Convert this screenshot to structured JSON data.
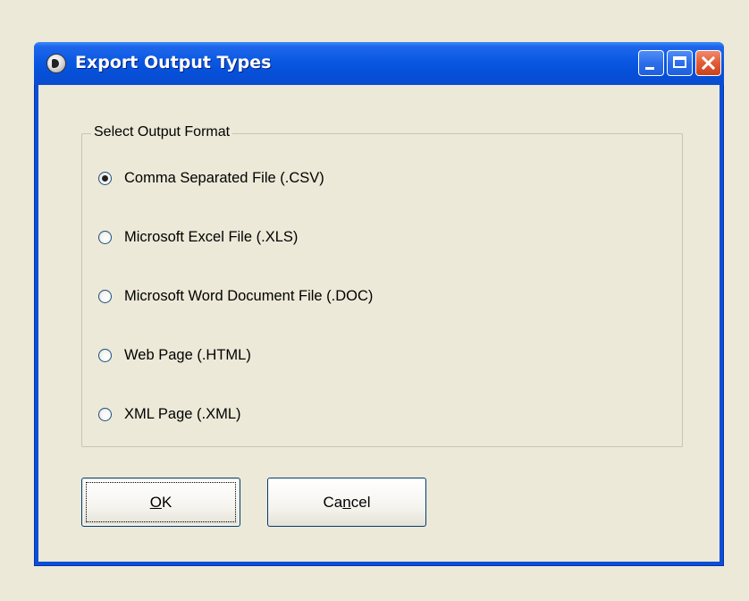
{
  "window": {
    "title": "Export Output Types",
    "icon": "app-globe-icon"
  },
  "titlebar_buttons": {
    "minimize": "minimize-icon",
    "maximize": "maximize-icon",
    "close": "close-icon"
  },
  "group": {
    "label": "Select Output Format",
    "options": [
      {
        "label": "Comma Separated File (.CSV)",
        "checked": true
      },
      {
        "label": "Microsoft Excel File (.XLS)",
        "checked": false
      },
      {
        "label": "Microsoft Word Document File (.DOC)",
        "checked": false
      },
      {
        "label": "Web Page (.HTML)",
        "checked": false
      },
      {
        "label": "XML Page (.XML)",
        "checked": false
      }
    ]
  },
  "buttons": {
    "ok": {
      "pre": "",
      "accel": "O",
      "post": "K"
    },
    "cancel": {
      "pre": "Ca",
      "accel": "n",
      "post": "cel"
    }
  },
  "colors": {
    "titlebar": "#0a58e2",
    "face": "#ECE9D8",
    "close": "#e15c36"
  }
}
